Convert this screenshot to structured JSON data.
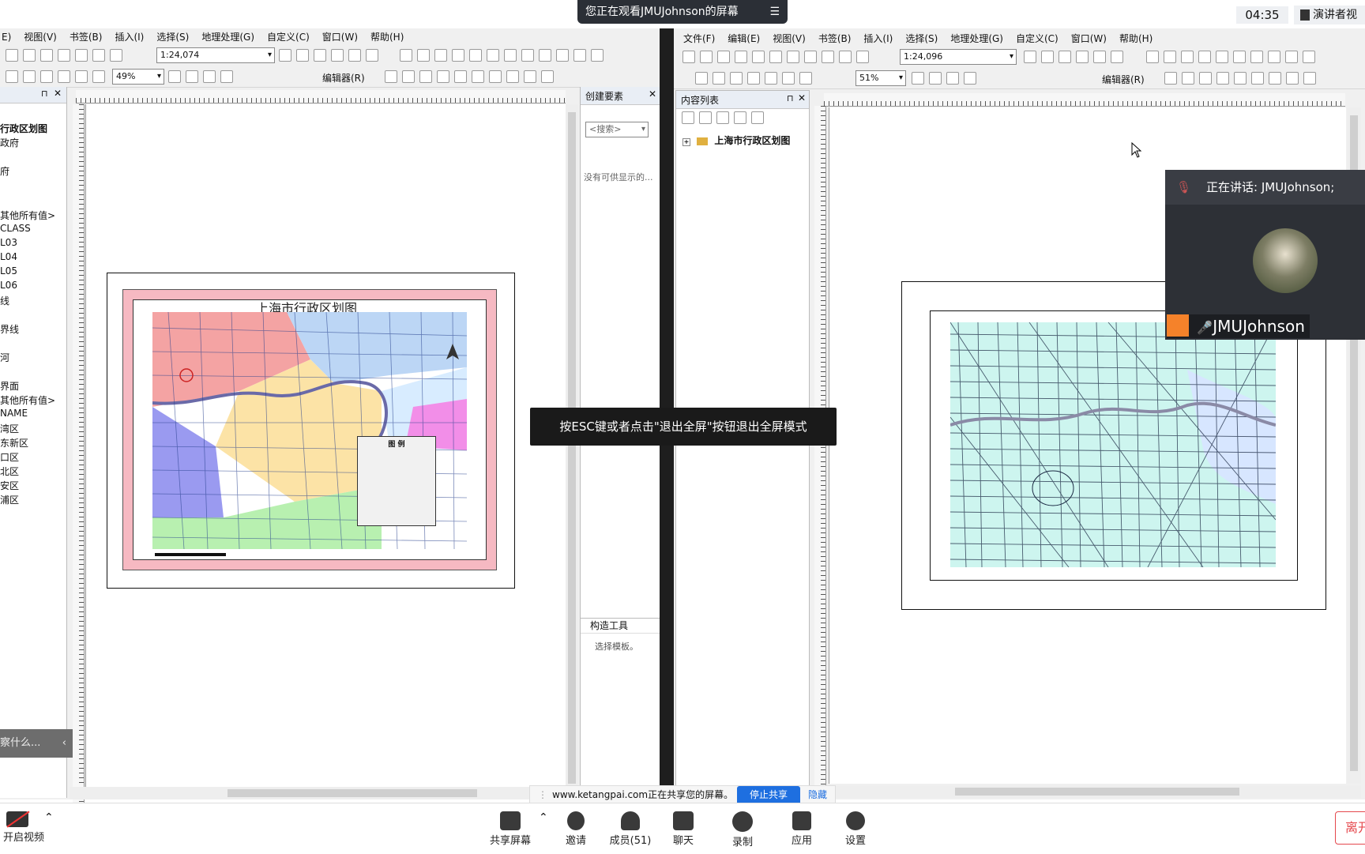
{
  "topbar": {
    "watching": "您正在观看JMUJohnson的屏幕",
    "time": "04:35",
    "presenter_view": "演讲者视"
  },
  "left_app": {
    "menus": [
      "E)",
      "视图(V)",
      "书签(B)",
      "插入(I)",
      "选择(S)",
      "地理处理(G)",
      "自定义(C)",
      "窗口(W)",
      "帮助(H)"
    ],
    "scale": "1:24,074",
    "zoom": "49%",
    "editor": "编辑器(R)",
    "toc_items": [
      "行政区划图",
      "政府",
      "府",
      "其他所有值>",
      "CLASS",
      "L03",
      "L04",
      "L05",
      "L06",
      "线",
      "界线",
      "河",
      "界面",
      "其他所有值>",
      "NAME",
      "湾区",
      "东新区",
      "口区",
      "北区",
      "安区",
      "浦区"
    ],
    "search_hint": "察什么...",
    "map_title": "上海市行政区划图",
    "legend_title": "图 例",
    "create_features": {
      "title": "创建要素",
      "search": "<搜索>",
      "empty": "没有可供显示的...",
      "construct": "构造工具",
      "choose": "选择模板。"
    }
  },
  "right_app": {
    "menus": [
      "文件(F)",
      "编辑(E)",
      "视图(V)",
      "书签(B)",
      "插入(I)",
      "选择(S)",
      "地理处理(G)",
      "自定义(C)",
      "窗口(W)",
      "帮助(H)"
    ],
    "scale": "1:24,096",
    "zoom": "51%",
    "editor": "编辑器(R)",
    "toc_title": "内容列表",
    "toc_layer": "上海市行政区划图"
  },
  "speaker": {
    "speaking": "正在讲话: JMUJohnson;",
    "name": "JMUJohnson"
  },
  "fullscreen_tip": "按ESC键或者点击\"退出全屏\"按钮退出全屏模式",
  "share_bar": {
    "text": "www.ketangpai.com正在共享您的屏幕。",
    "stop": "停止共享",
    "hide": "隐藏"
  },
  "bottom": {
    "video": "开启视频",
    "share": "共享屏幕",
    "invite": "邀请",
    "members": "成员(51)",
    "chat": "聊天",
    "record": "录制",
    "apps": "应用",
    "settings": "设置",
    "leave": "离开"
  },
  "colors": {
    "dark_bar": "#1f2329",
    "accent": "#1e6fe0",
    "leave": "#e5484d"
  }
}
